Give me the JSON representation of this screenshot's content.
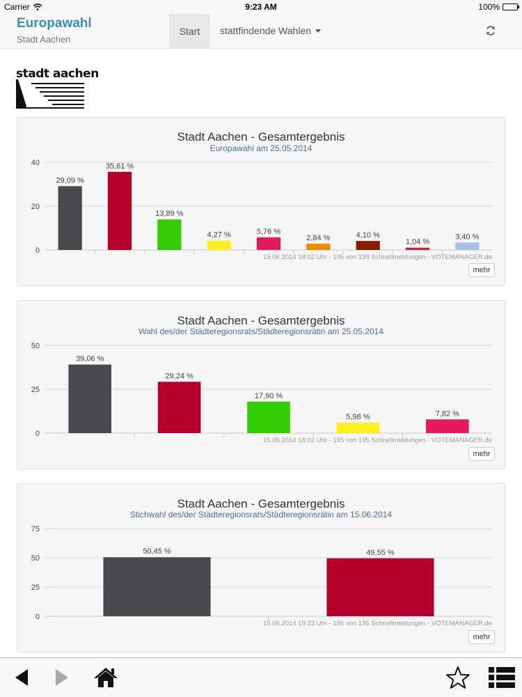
{
  "status_bar": {
    "carrier": "Carrier",
    "time": "9:23 AM",
    "battery": "100%"
  },
  "navbar": {
    "title": "Europawahl",
    "subtitle": "Stadt Aachen",
    "start_label": "Start",
    "elections_label": "stattfindende Wahlen"
  },
  "logo": {
    "text": "stadt aachen"
  },
  "charts": [
    {
      "title": "Stadt Aachen - Gesamtergebnis",
      "subtitle": "Europawahl am 25.05.2014",
      "footer": "15.06.2014 18:02 Uhr - 195 von 195 Schnellmeldungen - VOTEMANAGER.de",
      "more_label": "mehr"
    },
    {
      "title": "Stadt Aachen - Gesamtergebnis",
      "subtitle": "Wahl des/der Städteregionsrats/Städteregionsrätin am 25.05.2014",
      "footer": "15.06.2014 18:02 Uhr - 195 von 195 Schnellmeldungen - VOTEMANAGER.de",
      "more_label": "mehr"
    },
    {
      "title": "Stadt Aachen - Gesamtergebnis",
      "subtitle": "Stichwahl des/der Städteregionsrats/Städteregionsrätin am 15.06.2014",
      "footer": "15.06.2014 19:23 Uhr - 195 von 195 Schnellmeldungen - VOTEMANAGER.de",
      "more_label": "mehr"
    }
  ],
  "chart_data": [
    {
      "type": "bar",
      "title": "Stadt Aachen - Gesamtergebnis",
      "subtitle": "Europawahl am 25.05.2014",
      "ylim": [
        0,
        40
      ],
      "yticks": [
        0,
        20,
        40
      ],
      "grid": true,
      "values": [
        29.09,
        35.61,
        13.89,
        4.27,
        5.76,
        2.84,
        4.1,
        1.04,
        3.4
      ],
      "labels": [
        "29,09 %",
        "35,61 %",
        "13,89 %",
        "4,27 %",
        "5,76 %",
        "2,84 %",
        "4,10 %",
        "1,04 %",
        "3,40 %"
      ],
      "colors": [
        "#4a4a4e",
        "#b4002a",
        "#33cc00",
        "#ffee22",
        "#e21b5a",
        "#f08a00",
        "#8b1a00",
        "#d21f3c",
        "#a6c1e8"
      ]
    },
    {
      "type": "bar",
      "title": "Stadt Aachen - Gesamtergebnis",
      "subtitle": "Wahl des/der Städteregionsrats/Städteregionsrätin am 25.05.2014",
      "ylim": [
        0,
        50
      ],
      "yticks": [
        0,
        25,
        50
      ],
      "grid": true,
      "values": [
        39.06,
        29.24,
        17.9,
        5.98,
        7.82
      ],
      "labels": [
        "39,06 %",
        "29,24 %",
        "17,90 %",
        "5,98 %",
        "7,82 %"
      ],
      "colors": [
        "#4a4a4e",
        "#b4002a",
        "#33cc00",
        "#ffee22",
        "#e21b5a"
      ]
    },
    {
      "type": "bar",
      "title": "Stadt Aachen - Gesamtergebnis",
      "subtitle": "Stichwahl des/der Städteregionsrats/Städteregionsrätin am 15.06.2014",
      "ylim": [
        0,
        75
      ],
      "yticks": [
        0,
        25,
        50,
        75
      ],
      "grid": true,
      "values": [
        50.45,
        49.55
      ],
      "labels": [
        "50,45 %",
        "49,55 %"
      ],
      "colors": [
        "#4a4a4e",
        "#b4002a"
      ]
    }
  ],
  "toolbar": {
    "icons": [
      "back-arrow-icon",
      "forward-arrow-icon",
      "home-icon",
      "star-icon",
      "list-icon"
    ]
  }
}
